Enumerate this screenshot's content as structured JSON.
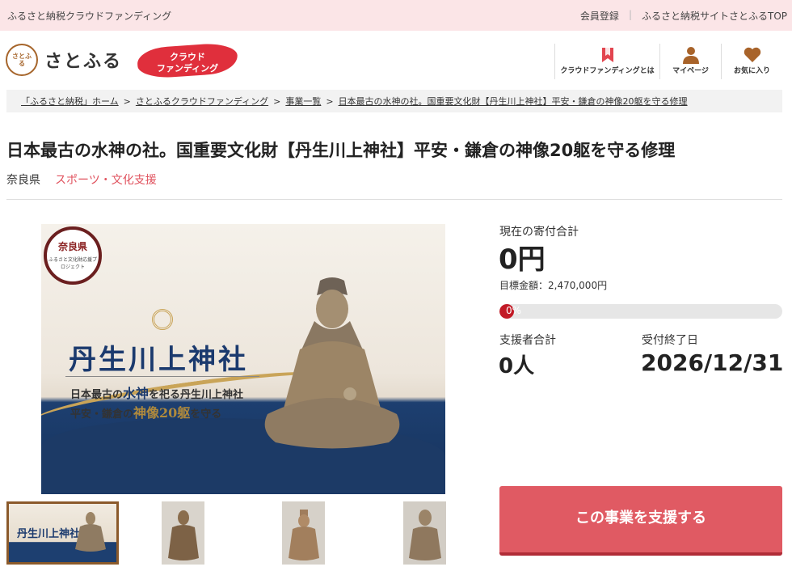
{
  "topbar": {
    "site_label": "ふるさと納税クラウドファンディング",
    "register": "会員登録",
    "top_link": "ふるさと納税サイトさとふるTOP"
  },
  "header": {
    "logo_mark": "さとふる",
    "logo_text": "さとふる",
    "badge_line1": "クラウド",
    "badge_line2": "ファンディング",
    "nav": [
      {
        "label": "クラウドファンディングとは",
        "icon": "bookmark-icon"
      },
      {
        "label": "マイページ",
        "icon": "person-icon"
      },
      {
        "label": "お気に入り",
        "icon": "heart-icon"
      }
    ]
  },
  "breadcrumb": [
    "「ふるさと納税」ホーム",
    "さとふるクラウドファンディング",
    "事業一覧",
    "日本最古の水神の社。国重要文化財【丹生川上神社】平安・鎌倉の神像20躯を守る修理"
  ],
  "breadcrumb_sep": ">",
  "project": {
    "title": "日本最古の水神の社。国重要文化財【丹生川上神社】平安・鎌倉の神像20躯を守る修理",
    "prefecture": "奈良県",
    "category": "スポーツ・文化支援"
  },
  "image": {
    "seal_top": "奈良県",
    "seal_sub": "ふるさと文化財応援プロジェクト",
    "heading": "丹生川上神社",
    "line1_pre": "日本最古の",
    "line1_em": "水神",
    "line1_post": "を祀る丹生川上神社",
    "line2_pre": "平安・鎌倉の",
    "line2_em": "神像20躯",
    "line2_post": "を守る",
    "thumb_heading": "丹生川上神社"
  },
  "stats": {
    "total_label": "現在の寄付合計",
    "total_value": "0円",
    "goal": "目標金額：2,470,000円",
    "progress_text": "0%",
    "progress": 0,
    "supporters_label": "支援者合計",
    "supporters_value": "0人",
    "end_label": "受付終了日",
    "end_value": "2026/12/31"
  },
  "cta": {
    "label": "この事業を支援する"
  },
  "colors": {
    "accent": "#e05a63",
    "topbar_bg": "#fbe5e7",
    "progress_fill": "#c21a26",
    "category": "#e0525e",
    "navy": "#1b3a6e",
    "gold": "#c9a458"
  }
}
